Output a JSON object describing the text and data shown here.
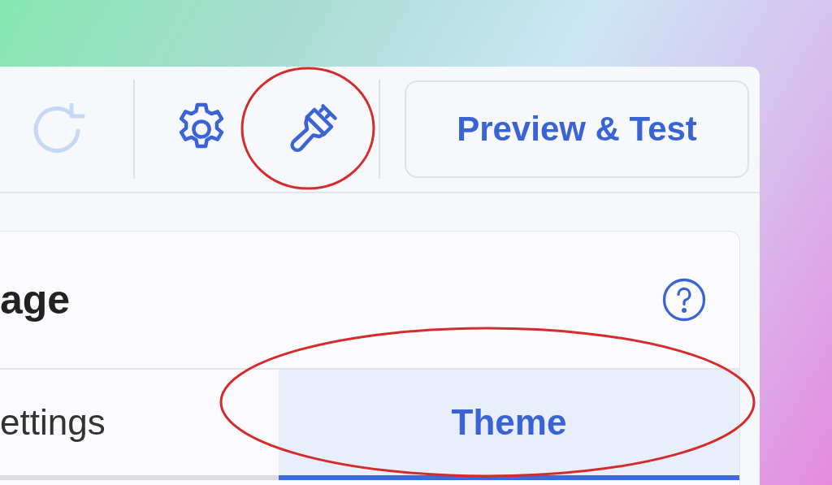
{
  "toolbar": {
    "tools": [
      {
        "kind": "redo",
        "disabled": true
      },
      {
        "kind": "settings",
        "disabled": false
      },
      {
        "kind": "brush",
        "disabled": false
      }
    ],
    "preview_button": "Preview & Test"
  },
  "panel": {
    "title": "age",
    "tabs": [
      {
        "label": "ettings",
        "selected": false
      },
      {
        "label": "Theme",
        "selected": true
      }
    ]
  },
  "annotations": [
    {
      "kind": "ellipse"
    },
    {
      "kind": "ellipse"
    }
  ]
}
